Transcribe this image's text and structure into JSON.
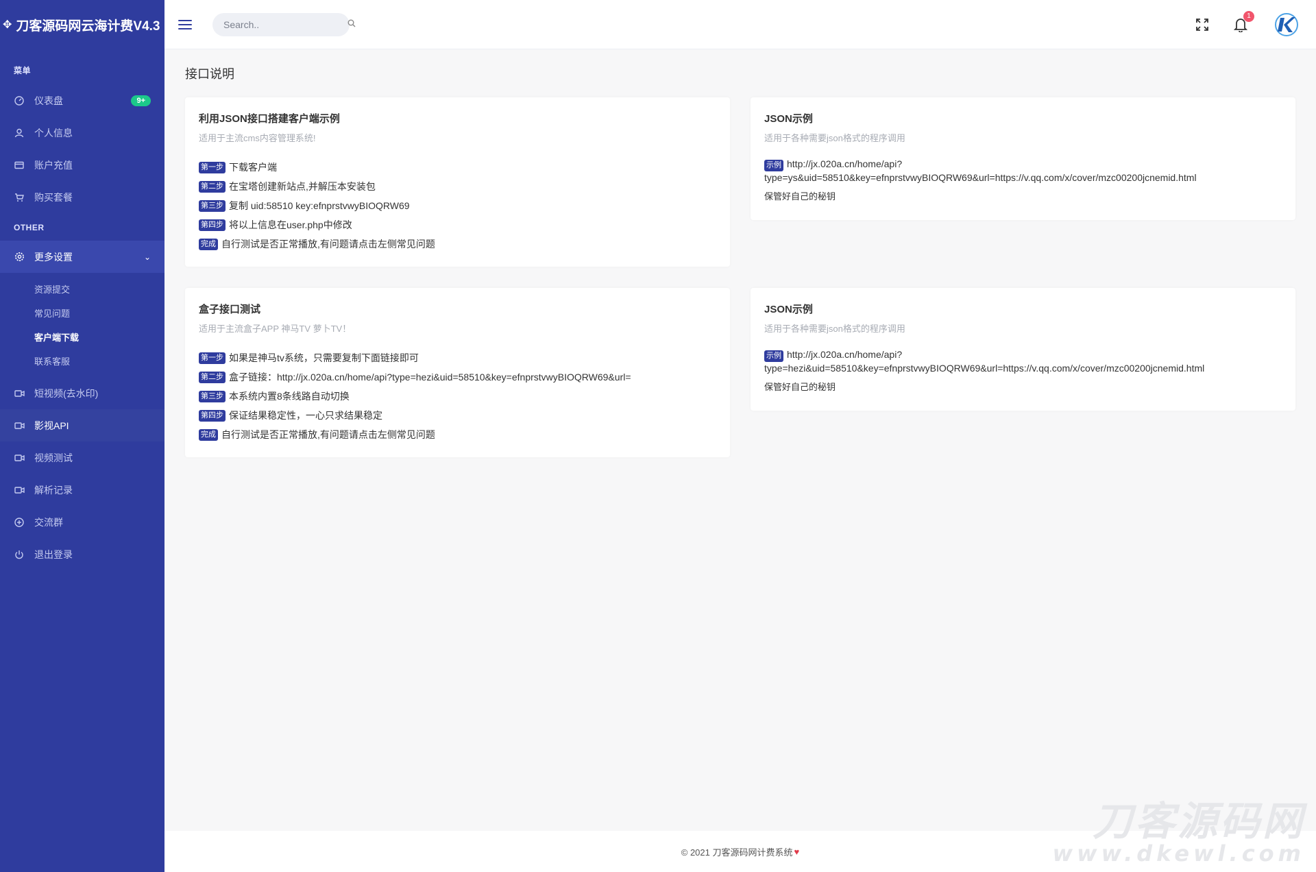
{
  "app": {
    "brand": "刀客源码网云海计费V4.3"
  },
  "colors": {
    "sidebar_bg": "#2f3c9e",
    "accent": "#2f3c9e",
    "badge_green": "#1cc88a",
    "notif_red": "#f1556c"
  },
  "sidebar": {
    "section_menu": "菜单",
    "menu_items": [
      {
        "label": "仪表盘",
        "icon": "dashboard-icon",
        "badge": "9+"
      },
      {
        "label": "个人信息",
        "icon": "user-icon"
      },
      {
        "label": "账户充值",
        "icon": "credit-card-icon"
      },
      {
        "label": "购买套餐",
        "icon": "cart-icon"
      }
    ],
    "section_other": "OTHER",
    "settings": {
      "label": "更多设置",
      "icon": "settings-icon"
    },
    "submenu": [
      {
        "label": "资源提交"
      },
      {
        "label": "常见问题"
      },
      {
        "label": "客户端下载",
        "active": true
      },
      {
        "label": "联系客服"
      }
    ],
    "bottom_items": [
      {
        "label": "短视频(去水印)",
        "icon": "video-icon"
      },
      {
        "label": "影视API",
        "icon": "video-icon",
        "current": true
      },
      {
        "label": "视频测试",
        "icon": "video-icon"
      },
      {
        "label": "解析记录",
        "icon": "video-icon"
      },
      {
        "label": "交流群",
        "icon": "plus-circle-icon"
      },
      {
        "label": "退出登录",
        "icon": "power-icon"
      }
    ]
  },
  "topbar": {
    "search_placeholder": "Search..",
    "notification_count": "1"
  },
  "main": {
    "page_title": "接口说明",
    "card1": {
      "title": "利用JSON接口搭建客户端示例",
      "subtitle": "适用于主流cms内容管理系统!",
      "steps": [
        {
          "tag": "第一步",
          "text": "下载客户端"
        },
        {
          "tag": "第二步",
          "text": "在宝塔创建新站点,并解压本安装包"
        },
        {
          "tag": "第三步",
          "text": "复制 uid:58510 key:efnprstvwyBIOQRW69"
        },
        {
          "tag": "第四步",
          "text": "将以上信息在user.php中修改"
        },
        {
          "tag": "完成",
          "text": "自行测试是否正常播放,有问题请点击左侧常见问题"
        }
      ]
    },
    "card2": {
      "title": "JSON示例",
      "subtitle": "适用于各种需要json格式的程序调用",
      "tag": "示例",
      "line1": "http://jx.020a.cn/home/api?",
      "line2": "type=ys&uid=58510&key=efnprstvwyBIOQRW69&url=https://v.qq.com/x/cover/mzc00200jcnemid.html",
      "note": "保管好自己的秘钥"
    },
    "card3": {
      "title": "盒子接口测试",
      "subtitle": "适用于主流盒子APP 神马TV 萝卜TV！",
      "steps": [
        {
          "tag": "第一步",
          "text": "如果是神马tv系统，只需要复制下面链接即可"
        },
        {
          "tag": "第二步",
          "text": "盒子链接：http://jx.020a.cn/home/api?type=hezi&uid=58510&key=efnprstvwyBIOQRW69&url="
        },
        {
          "tag": "第三步",
          "text": "本系统内置8条线路自动切换"
        },
        {
          "tag": "第四步",
          "text": "保证结果稳定性，一心只求结果稳定"
        },
        {
          "tag": "完成",
          "text": "自行测试是否正常播放,有问题请点击左侧常见问题"
        }
      ]
    },
    "card4": {
      "title": "JSON示例",
      "subtitle": "适用于各种需要json格式的程序调用",
      "tag": "示例",
      "line1": "http://jx.020a.cn/home/api?",
      "line2": "type=hezi&uid=58510&key=efnprstvwyBIOQRW69&url=https://v.qq.com/x/cover/mzc00200jcnemid.html",
      "note": "保管好自己的秘钥"
    }
  },
  "footer": {
    "text": "© 2021 刀客源码网计费系统"
  },
  "watermark": {
    "main": "刀客源码网",
    "url": "www.dkewl.com"
  }
}
